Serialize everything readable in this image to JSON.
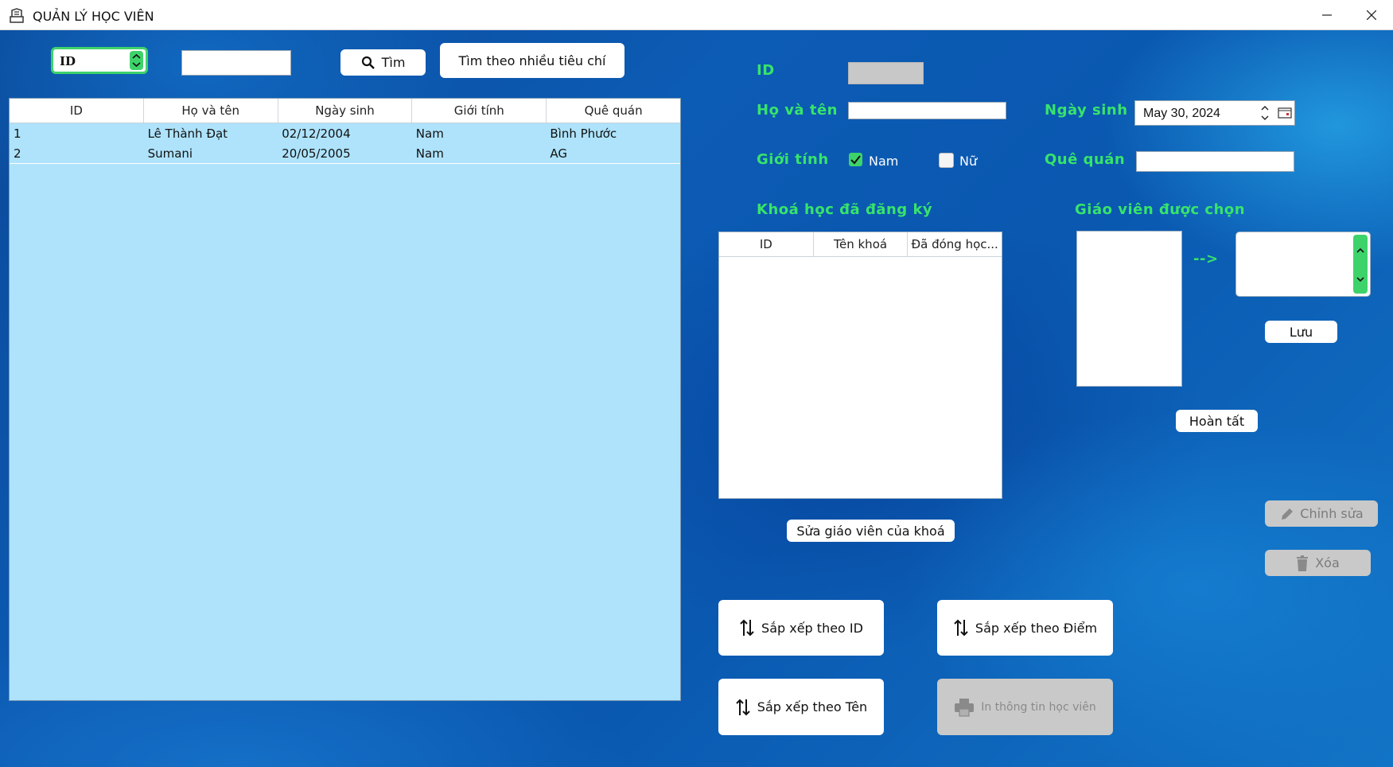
{
  "window": {
    "title": "QUẢN LÝ HỌC VIÊN"
  },
  "search": {
    "field_combo": "ID",
    "search_value": "",
    "search_button": "Tìm",
    "multi_criteria_button": "Tìm theo nhiều tiêu chí"
  },
  "students_table": {
    "headers": [
      "ID",
      "Họ và tên",
      "Ngày sinh",
      "Giới tính",
      "Quê quán"
    ],
    "rows": [
      [
        "1",
        "Lê Thành Đạt",
        "02/12/2004",
        "Nam",
        "Bình Phước"
      ],
      [
        "2",
        "Sumani",
        "20/05/2005",
        "Nam",
        "AG"
      ]
    ]
  },
  "form": {
    "id_label": "ID",
    "id_value": "",
    "name_label": "Họ và tên",
    "name_value": "",
    "dob_label": "Ngày sinh",
    "dob_value": "May 30, 2024",
    "gender_label": "Giới tính",
    "gender_male": "Nam",
    "gender_female": "Nữ",
    "gender_male_checked": true,
    "gender_female_checked": false,
    "hometown_label": "Quê quán",
    "hometown_value": ""
  },
  "courses": {
    "label": "Khoá học đã đăng ký",
    "headers": [
      "ID",
      "Tên khoá",
      "Đã đóng học..."
    ],
    "rows": []
  },
  "teacher": {
    "label": "Giáo viên được chọn",
    "arrow": "-->",
    "save_button": "Lưu",
    "done_button": "Hoàn tất"
  },
  "actions": {
    "edit_course_teacher": "Sửa giáo viên của khoá",
    "edit_button": "Chỉnh sửa",
    "delete_button": "Xóa",
    "sort_id": "Sắp xếp theo ID",
    "sort_score": "Sắp xếp theo Điểm",
    "sort_name": "Sắp xếp theo Tên",
    "print_info": "In thông tin học viên"
  },
  "colors": {
    "label_green": "#37e46a",
    "table_row_bg": "#aee3fb",
    "disabled_button": "#c9c9c9"
  }
}
